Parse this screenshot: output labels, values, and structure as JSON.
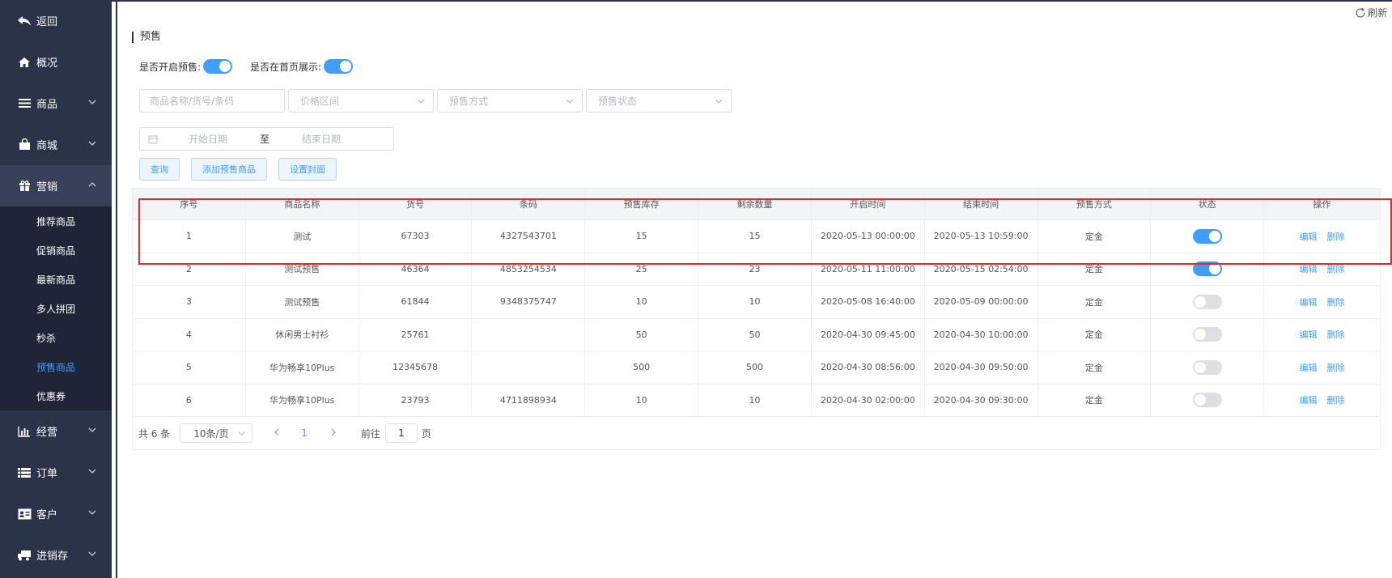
{
  "sidebar": {
    "items": [
      {
        "label": "返回",
        "icon": "back-icon"
      },
      {
        "label": "概况",
        "icon": "home-icon"
      },
      {
        "label": "商品",
        "icon": "menu-icon"
      },
      {
        "label": "商城",
        "icon": "shop-bag-icon"
      },
      {
        "label": "营销",
        "icon": "gift-icon"
      }
    ],
    "sub_items": [
      {
        "label": "推荐商品"
      },
      {
        "label": "促销商品"
      },
      {
        "label": "最新商品"
      },
      {
        "label": "多人拼团"
      },
      {
        "label": "秒杀"
      },
      {
        "label": "预售商品"
      },
      {
        "label": "优惠券"
      }
    ],
    "bottom_items": [
      {
        "label": "经营",
        "icon": "bar-chart-icon"
      },
      {
        "label": "订单",
        "icon": "list-icon"
      },
      {
        "label": "客户",
        "icon": "id-card-icon"
      },
      {
        "label": "进销存",
        "icon": "truck-icon"
      }
    ],
    "selected_sub": "预售商品",
    "accent_color": "#409eff"
  },
  "header": {
    "refresh_label": "刷新",
    "title": "预售"
  },
  "toggles": {
    "presale_label": "是否开启预售:",
    "presale_on": true,
    "homepage_label": "是否在首页展示:",
    "homepage_on": true
  },
  "filters": {
    "name_placeholder": "商品名称/货号/条码",
    "price_placeholder": "价格区间",
    "method_placeholder": "预售方式",
    "status_placeholder": "预售状态",
    "start_date_placeholder": "开始日期",
    "range_separator": "至",
    "end_date_placeholder": "结束日期"
  },
  "buttons": {
    "query": "查询",
    "add": "添加预售商品",
    "cover": "设置封面"
  },
  "table": {
    "columns": [
      "序号",
      "商品名称",
      "货号",
      "条码",
      "预售库存",
      "剩余数量",
      "开启时间",
      "结束时间",
      "预售方式",
      "状态",
      "操作"
    ],
    "edit_label": "编辑",
    "delete_label": "删除",
    "rows": [
      {
        "no": "1",
        "name": "测试",
        "sku": "67303",
        "barcode": "4327543701",
        "stock": "15",
        "remain": "15",
        "start": "2020-05-13 00:00:00",
        "end": "2020-05-13 10:59:00",
        "method": "定金",
        "status": true
      },
      {
        "no": "2",
        "name": "测试预售",
        "sku": "46364",
        "barcode": "4853254534",
        "stock": "25",
        "remain": "23",
        "start": "2020-05-11 11:00:00",
        "end": "2020-05-15 02:54:00",
        "method": "定金",
        "status": true
      },
      {
        "no": "3",
        "name": "测试预售",
        "sku": "61844",
        "barcode": "9348375747",
        "stock": "10",
        "remain": "10",
        "start": "2020-05-08 16:40:00",
        "end": "2020-05-09 00:00:00",
        "method": "定金",
        "status": false
      },
      {
        "no": "4",
        "name": "休闲男士衬衫",
        "sku": "25761",
        "barcode": "",
        "stock": "50",
        "remain": "50",
        "start": "2020-04-30 09:45:00",
        "end": "2020-04-30 10:00:00",
        "method": "定金",
        "status": false
      },
      {
        "no": "5",
        "name": "华为畅享10Plus",
        "sku": "12345678",
        "barcode": "",
        "stock": "500",
        "remain": "500",
        "start": "2020-04-30 08:56:00",
        "end": "2020-04-30 09:50:00",
        "method": "定金",
        "status": false
      },
      {
        "no": "6",
        "name": "华为畅享10Plus",
        "sku": "23793",
        "barcode": "4711898934",
        "stock": "10",
        "remain": "10",
        "start": "2020-04-30 02:00:00",
        "end": "2020-04-30 09:30:00",
        "method": "定金",
        "status": false
      }
    ]
  },
  "pager": {
    "total": "共 6 条",
    "page_size": "10条/页",
    "current_page": "1",
    "goto_label": "前往",
    "goto_value": "1",
    "page_suffix": "页"
  },
  "highlight_color": "#e62a2a"
}
